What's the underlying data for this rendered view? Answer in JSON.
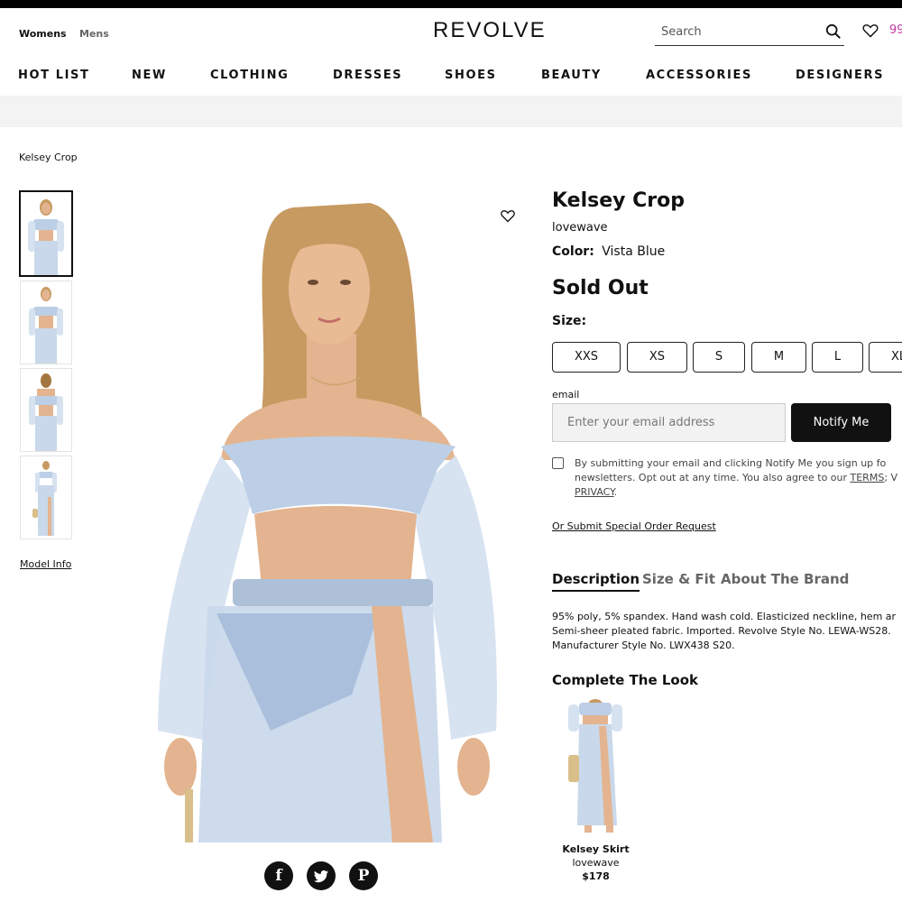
{
  "header": {
    "gender_womens": "Womens",
    "gender_mens": "Mens",
    "logo": "REVOLVE",
    "search_placeholder": "Search",
    "bag_count": "99"
  },
  "nav": [
    "HOT LIST",
    "NEW",
    "CLOTHING",
    "DRESSES",
    "SHOES",
    "BEAUTY",
    "ACCESSORIES",
    "DESIGNERS"
  ],
  "breadcrumb": "Kelsey Crop",
  "gallery": {
    "thumbnails": 4,
    "active_thumbnail": 1,
    "model_info": "Model Info"
  },
  "product": {
    "title": "Kelsey Crop",
    "brand": "lovewave",
    "color_label": "Color:",
    "color_value": "Vista Blue",
    "stock_status": "Sold Out",
    "size_label": "Size:",
    "sizes": [
      "XXS",
      "XS",
      "S",
      "M",
      "L",
      "XL"
    ]
  },
  "notify": {
    "email_label": "email",
    "email_placeholder": "Enter your email address",
    "button": "Notify Me",
    "consent_line1": "By submitting your email and clicking Notify Me you sign up fo",
    "consent_line2a": "newsletters. Opt out at any time. You also agree to our ",
    "consent_terms": "TERMS",
    "consent_line2b": "; V",
    "consent_privacy": "PRIVACY",
    "consent_end": "."
  },
  "special_order": "Or Submit Special Order Request",
  "tabs": [
    "Description",
    "Size & Fit",
    "About The Brand"
  ],
  "description": {
    "line1": "95% poly, 5% spandex. Hand wash cold. Elasticized neckline, hem ar",
    "line2": "Semi-sheer pleated fabric. Imported. Revolve Style No. LEWA-WS28.",
    "line3": "Manufacturer Style No. LWX438 S20."
  },
  "complete_the_look": {
    "title": "Complete The Look",
    "item_name": "Kelsey Skirt",
    "item_brand": "lovewave",
    "item_price": "$178"
  },
  "social_icons": [
    "facebook-icon",
    "twitter-icon",
    "pinterest-icon"
  ],
  "colors": {
    "garment": "#bccfe6",
    "skin": "#e3b48f",
    "hair": "#c79a62",
    "accent": "#c03a9e",
    "band": "#f3f3f3"
  }
}
